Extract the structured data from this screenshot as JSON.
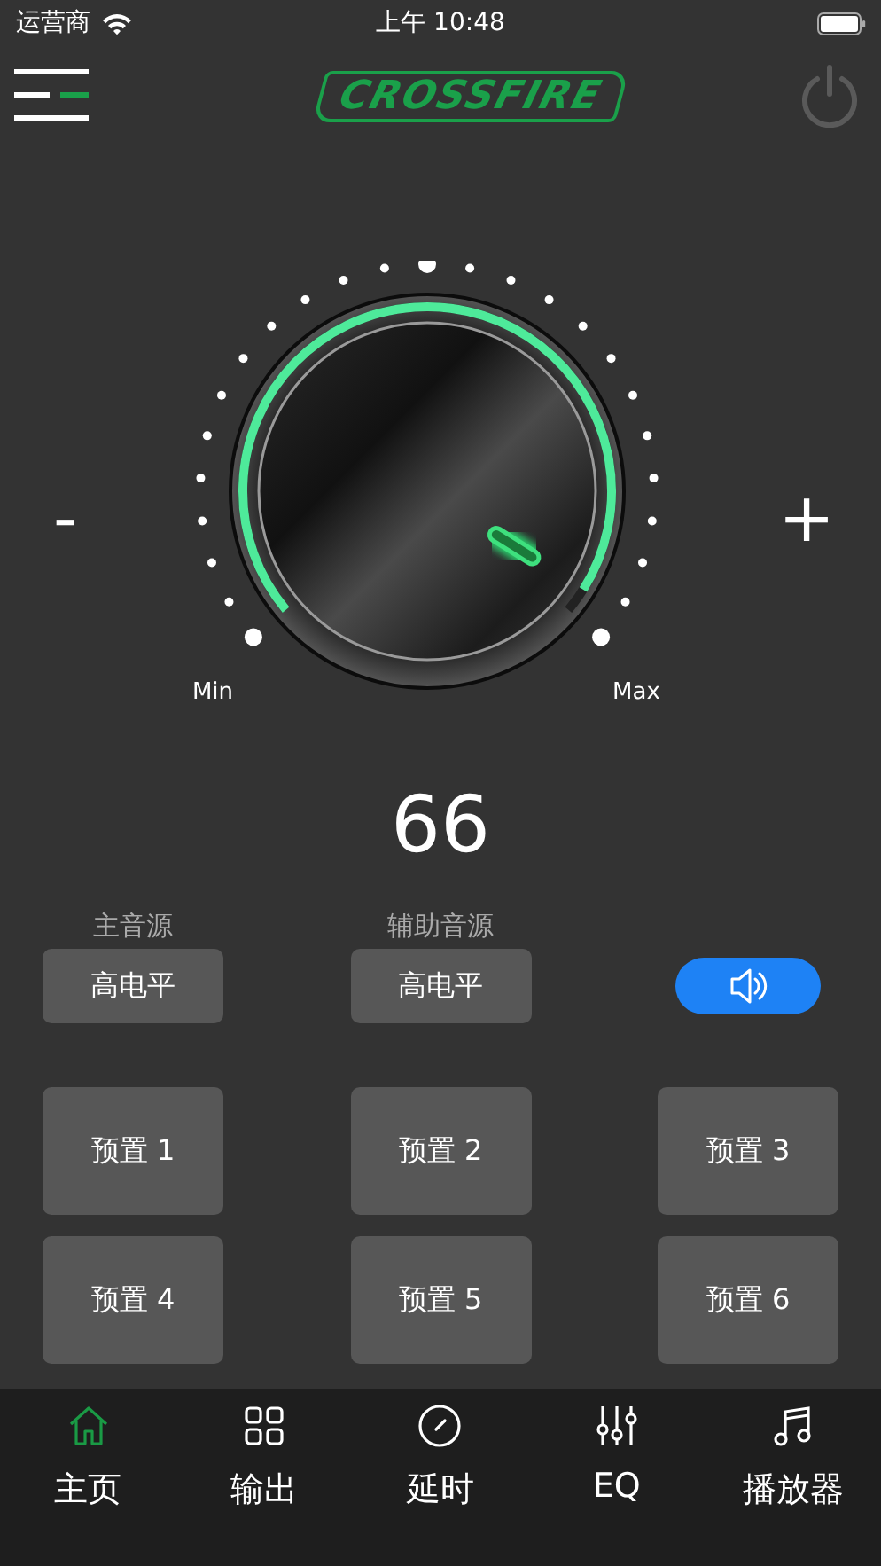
{
  "status_bar": {
    "carrier": "运营商",
    "time": "上午 10:48"
  },
  "header": {
    "logo": "CROSSFIRE"
  },
  "volume": {
    "minus": "-",
    "plus": "+",
    "min_label": "Min",
    "max_label": "Max",
    "level": 0.97,
    "value": "66"
  },
  "sources": [
    {
      "label": "主音源",
      "value": "高电平"
    },
    {
      "label": "辅助音源",
      "value": "高电平"
    }
  ],
  "speaker": {
    "on": true
  },
  "presets": [
    "预置 1",
    "预置 2",
    "预置 3",
    "预置 4",
    "预置 5",
    "预置 6"
  ],
  "tabs": [
    {
      "label": "主页",
      "kind": "home",
      "selected": true
    },
    {
      "label": "输出",
      "kind": "grid",
      "selected": false
    },
    {
      "label": "延时",
      "kind": "gauge",
      "selected": false
    },
    {
      "label": "EQ",
      "kind": "sliders",
      "selected": false
    },
    {
      "label": "播放器",
      "kind": "music",
      "selected": false
    }
  ]
}
